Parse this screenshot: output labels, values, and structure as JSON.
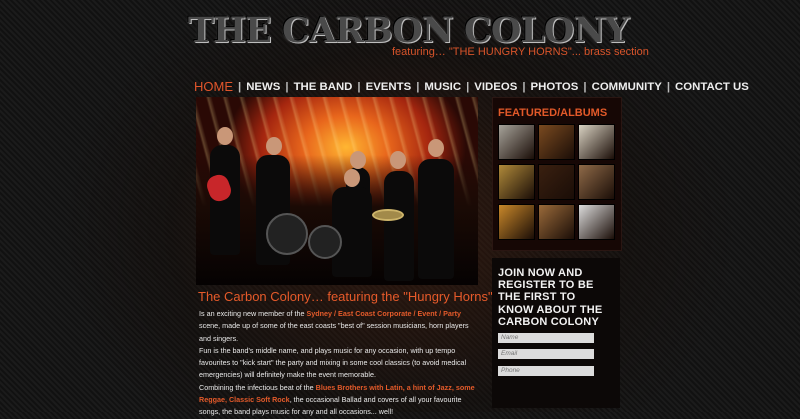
{
  "header": {
    "logo_text": "THE CARBON COLONY",
    "tagline": "featuring…  \"THE HUNGRY HORNS\"... brass section"
  },
  "nav": {
    "items": [
      "HOME",
      "NEWS",
      "THE BAND",
      "EVENTS",
      "MUSIC",
      "VIDEOS",
      "PHOTOS",
      "COMMUNITY",
      "CONTACT US"
    ],
    "active": "HOME",
    "accent": "#e0552b"
  },
  "hero": {
    "photo": "band-photo-orange-background"
  },
  "content": {
    "headline": "The Carbon Colony… featuring the \"Hungry Horns\"",
    "p1": {
      "a": "Is an exciting new member of the ",
      "b": "Sydney / East Coast Corporate / Event / Party",
      "c": " scene, made up of some of the east coasts \"best of\" session musicians, horn players and singers."
    },
    "p2": "Fun is the band's middle name, and plays music for any occasion, with up tempo favourites to \"kick start\" the party and mixing in some cool classics (to avoid medical emergencies) will definitely make the event memorable.",
    "p3": {
      "a": "Combining the infectious beat of the ",
      "b": "Blues Brothers with Latin, a hint of Jazz, some Reggae, Classic Soft Rock",
      "c": ", the occasional Ballad and covers of all your favourite songs, the band plays music for any and all occasions... well!"
    }
  },
  "albums": {
    "title": "FEATURED/ALBUMS",
    "thumbs": [
      {
        "name": "guitar-thumb",
        "color": "#a7a39a"
      },
      {
        "name": "crowd-thumb",
        "color": "#7a4a20"
      },
      {
        "name": "stage-light-thumb",
        "color": "#d9d2c2"
      },
      {
        "name": "music-sheet-thumb",
        "color": "#b08a3a"
      },
      {
        "name": "sparkle-thumb",
        "color": "#3a2010"
      },
      {
        "name": "piano-keys-thumb",
        "color": "#8f6a48"
      },
      {
        "name": "spotlight-thumb",
        "color": "#c9882a"
      },
      {
        "name": "trumpet-thumb",
        "color": "#9a6a3a"
      },
      {
        "name": "notes-thumb",
        "color": "#dcdcdc"
      }
    ]
  },
  "join": {
    "title": "JOIN NOW AND REGISTER TO BE THE FIRST TO KNOW ABOUT THE CARBON COLONY",
    "fields": [
      {
        "name": "name-field",
        "placeholder": "Name"
      },
      {
        "name": "email-field",
        "placeholder": "Email"
      },
      {
        "name": "phone-field",
        "placeholder": "Phone"
      }
    ]
  }
}
